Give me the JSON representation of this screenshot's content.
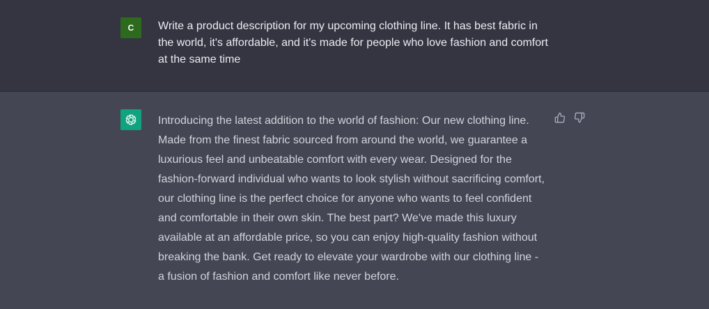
{
  "user_message": {
    "avatar_letter": "C",
    "text": "Write a product description for my upcoming clothing line. It has best fabric in the world, it's affordable, and it's made for people who love fashion and comfort at the same time"
  },
  "assistant_message": {
    "avatar_icon": "openai-logo-icon",
    "text": "Introducing the latest addition to the world of fashion: Our new clothing line. Made from the finest fabric sourced from around the world, we guarantee a luxurious feel and unbeatable comfort with every wear. Designed for the fashion-forward individual who wants to look stylish without sacrificing comfort, our clothing line is the perfect choice for anyone who wants to feel confident and comfortable in their own skin. The best part? We've made this luxury available at an affordable price, so you can enjoy high-quality fashion without breaking the bank. Get ready to elevate your wardrobe with our clothing line - a fusion of fashion and comfort like never before."
  },
  "feedback": {
    "up_icon": "thumbs-up-icon",
    "down_icon": "thumbs-down-icon"
  },
  "colors": {
    "user_bg": "#343541",
    "assistant_bg": "#444654",
    "user_avatar": "#2d6a1e",
    "assistant_avatar": "#10a37f"
  }
}
